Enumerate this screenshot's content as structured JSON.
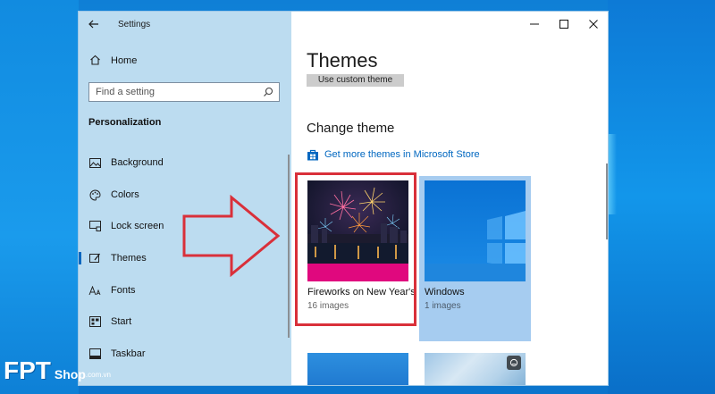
{
  "window": {
    "title": "Settings",
    "controls": {
      "minimize": "minimize",
      "maximize": "maximize",
      "close": "close"
    }
  },
  "sidebar": {
    "home_label": "Home",
    "search_placeholder": "Find a setting",
    "section_title": "Personalization",
    "items": [
      {
        "label": "Background",
        "icon": "picture-icon"
      },
      {
        "label": "Colors",
        "icon": "palette-icon"
      },
      {
        "label": "Lock screen",
        "icon": "lock-screen-icon"
      },
      {
        "label": "Themes",
        "icon": "themes-icon",
        "selected": true
      },
      {
        "label": "Fonts",
        "icon": "font-icon"
      },
      {
        "label": "Start",
        "icon": "start-icon"
      },
      {
        "label": "Taskbar",
        "icon": "taskbar-icon"
      }
    ]
  },
  "main": {
    "title": "Themes",
    "custom_theme_button": "Use custom theme",
    "change_theme_heading": "Change theme",
    "store_link": "Get more themes in Microsoft Store",
    "themes": [
      {
        "name": "Fireworks on New Year's",
        "subtitle": "16 images",
        "accent": "#e0087e"
      },
      {
        "name": "Windows",
        "subtitle": "1 images",
        "selected": true
      }
    ]
  },
  "branding": {
    "logo_main": "FPT",
    "logo_shop": "Shop",
    "logo_domain": ".com.vn"
  },
  "colors": {
    "accent": "#0067c0",
    "highlight": "#d9303a",
    "sidebar_bg": "#bcdcf0"
  }
}
